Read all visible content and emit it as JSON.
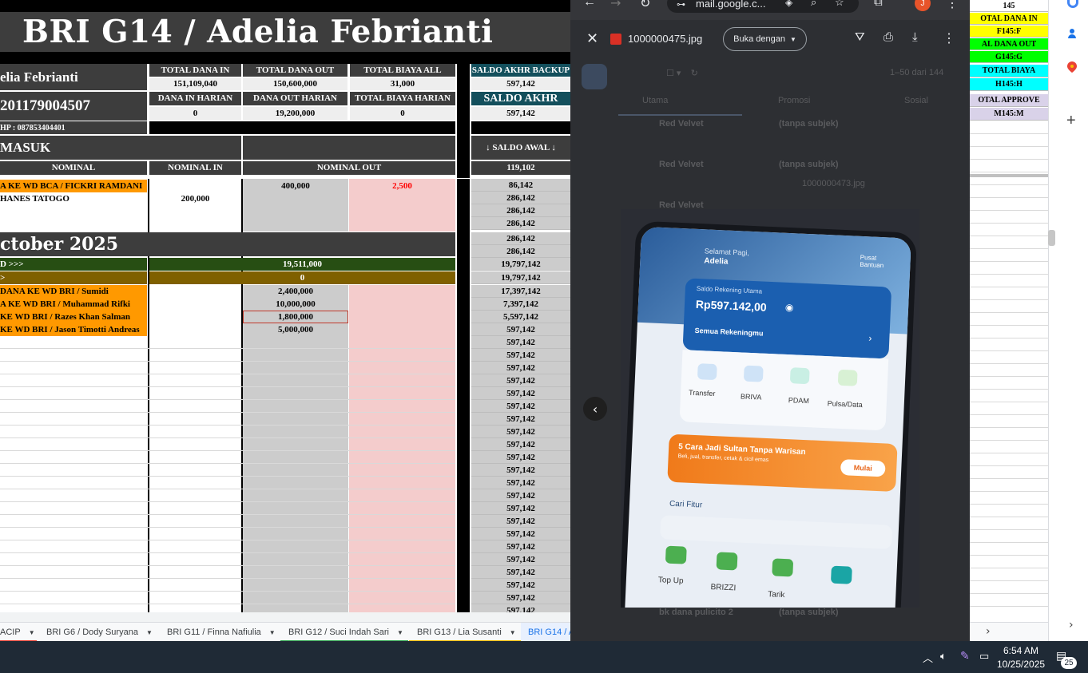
{
  "sheet": {
    "title": "BRI G14 / Adelia Febrianti",
    "account_name": "elia Febrianti",
    "account_number": "201179004507",
    "phone": "HP : 087853404401",
    "headers": {
      "total_dana_in": "TOTAL DANA IN",
      "total_dana_out": "TOTAL DANA OUT",
      "total_biaya_all": "TOTAL BIAYA ALL",
      "saldo_akhr_backup": "SALDO AKHR BACKUP",
      "dana_in_harian": "DANA IN HARIAN",
      "dana_out_harian": "DANA OUT HARIAN",
      "total_biaya_harian": "TOTAL BIAYA HARIAN",
      "saldo_akhr": "SALDO AKHR",
      "saldo_awal": "↓ SALDO AWAL ↓",
      "masuk": "MASUK",
      "nominal": "NOMINAL",
      "nominal_in": "NOMINAL IN",
      "nominal_out": "NOMINAL OUT"
    },
    "values": {
      "total_dana_in": "151,109,040",
      "total_dana_out": "150,600,000",
      "total_biaya_all": "31,000",
      "saldo_akhr_backup": "597,142",
      "dana_in_harian": "0",
      "dana_out_harian": "19,200,000",
      "total_biaya_harian": "0",
      "saldo_akhr": "597,142",
      "saldo_awal": "119,102"
    },
    "section1_rows": [
      {
        "desc": "A KE WD BCA / FICKRI RAMDANI",
        "in": "",
        "out": "400,000",
        "fee": "2,500",
        "bal": "86,142"
      },
      {
        "desc": "HANES TATOGO",
        "in": "200,000",
        "out": "",
        "fee": "",
        "bal": "286,142"
      },
      {
        "desc": "",
        "in": "",
        "out": "",
        "fee": "",
        "bal": "286,142"
      },
      {
        "desc": "",
        "in": "",
        "out": "",
        "fee": "",
        "bal": "286,142"
      }
    ],
    "month_title": "ctober 2025",
    "month_bal1": "286,142",
    "month_bal2": "286,142",
    "summary_in_label": "D >>>",
    "summary_in_value": "19,511,000",
    "summary_in_bal": "19,797,142",
    "summary_out_label": ">",
    "summary_out_value": "0",
    "summary_out_bal": "19,797,142",
    "section2_rows": [
      {
        "desc": " DANA KE WD BRI / Sumidi",
        "out": "2,400,000",
        "bal": "17,397,142"
      },
      {
        "desc": "A KE WD BRI / Muhammad Rifki",
        "out": "10,000,000",
        "bal": "7,397,142"
      },
      {
        "desc": " KE WD BRI / Razes Khan Salman",
        "out": "1,800,000",
        "bal": "5,597,142"
      },
      {
        "desc": "KE WD BRI / Jason Timotti Andreas",
        "out": "5,000,000",
        "bal": "597,142"
      }
    ],
    "repeat_balance": "597,142"
  },
  "tabs": [
    {
      "label": "ACIP"
    },
    {
      "label": "BRI G6 / Dody Suryana"
    },
    {
      "label": "BRI G11 / Finna Nafiulia"
    },
    {
      "label": "BRI G12 / Suci Indah Sari"
    },
    {
      "label": "BRI G13 / Lia Susanti"
    },
    {
      "label": "BRI G14 / A"
    }
  ],
  "right_sheet": {
    "r0": "145",
    "r1": "OTAL DANA IN",
    "r2": "F145:F",
    "r3": "AL DANA OUT",
    "r4": "G145:G",
    "r5": "TOTAL BIAYA",
    "r6": "H145:H",
    "r7": "OTAL APPROVE",
    "r8": "M145:M"
  },
  "browser": {
    "url": "mail.google.c...",
    "avatar_letter": "J"
  },
  "viewer": {
    "filename": "1000000475.jpg",
    "open_with": "Buka dengan",
    "bg_rows": [
      {
        "from": "Red Velvet",
        "subject": "(tanpa subjek)"
      },
      {
        "from": "Red Velvet",
        "subject": "(tanpa subjek)"
      },
      {
        "from": "Red Velvet",
        "subject": ""
      },
      {
        "from": "bk dana pulicito 2",
        "subject": "(tanpa subjek)"
      }
    ],
    "bg_tabs": [
      "Utama",
      "Promosi",
      "Sosial"
    ],
    "bg_counter": "1–50 dari 144",
    "bg_attach": "1000000473.jpg"
  },
  "phone": {
    "greeting": "Selamat Pagi,",
    "user": "Adelia",
    "help": "Pusat Bantuan",
    "saldo_label": "Saldo Rekening Utama",
    "saldo_value": "Rp597.142,00",
    "semua": "Semua Rekeningmu",
    "icons": [
      "Transfer",
      "BRIVA",
      "PDAM",
      "Pulsa/Data"
    ],
    "promo_title": "5 Cara Jadi Sultan Tanpa Warisan",
    "promo_sub": "Beli, jual, transfer, cetak & cicil emas",
    "promo_button": "Mulai",
    "search": "Cari Fitur",
    "bottom_icons": [
      "Top Up",
      "BRIZZI",
      "Tarik",
      ""
    ]
  },
  "taskbar": {
    "time": "6:54 AM",
    "date": "10/25/2025",
    "notif_count": "25"
  }
}
